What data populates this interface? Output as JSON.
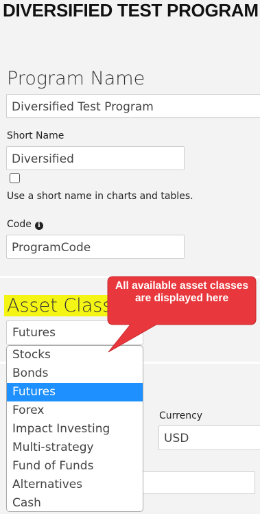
{
  "page": {
    "title": "DIVERSIFIED TEST PROGRAM"
  },
  "program_name": {
    "heading": "Program Name",
    "value": "Diversified Test Program"
  },
  "short_name": {
    "label": "Short Name",
    "value": "Diversified",
    "checkbox_label": "Use a short name in charts and tables.",
    "checked": false
  },
  "code": {
    "label": "Code",
    "icon": "info-circle-icon",
    "value": "ProgramCode"
  },
  "asset_class": {
    "heading": "Asset Class",
    "selected": "Futures",
    "options": [
      "Stocks",
      "Bonds",
      "Futures",
      "Forex",
      "Impact Investing",
      "Multi-strategy",
      "Fund of Funds",
      "Alternatives",
      "Cash"
    ],
    "highlight_color": "#f4f415",
    "selected_option_color": "#1e90ff"
  },
  "currency": {
    "label": "Currency",
    "value": "USD"
  },
  "annotation": {
    "text": "All available asset classes are displayed here",
    "color": "#e8383d"
  }
}
